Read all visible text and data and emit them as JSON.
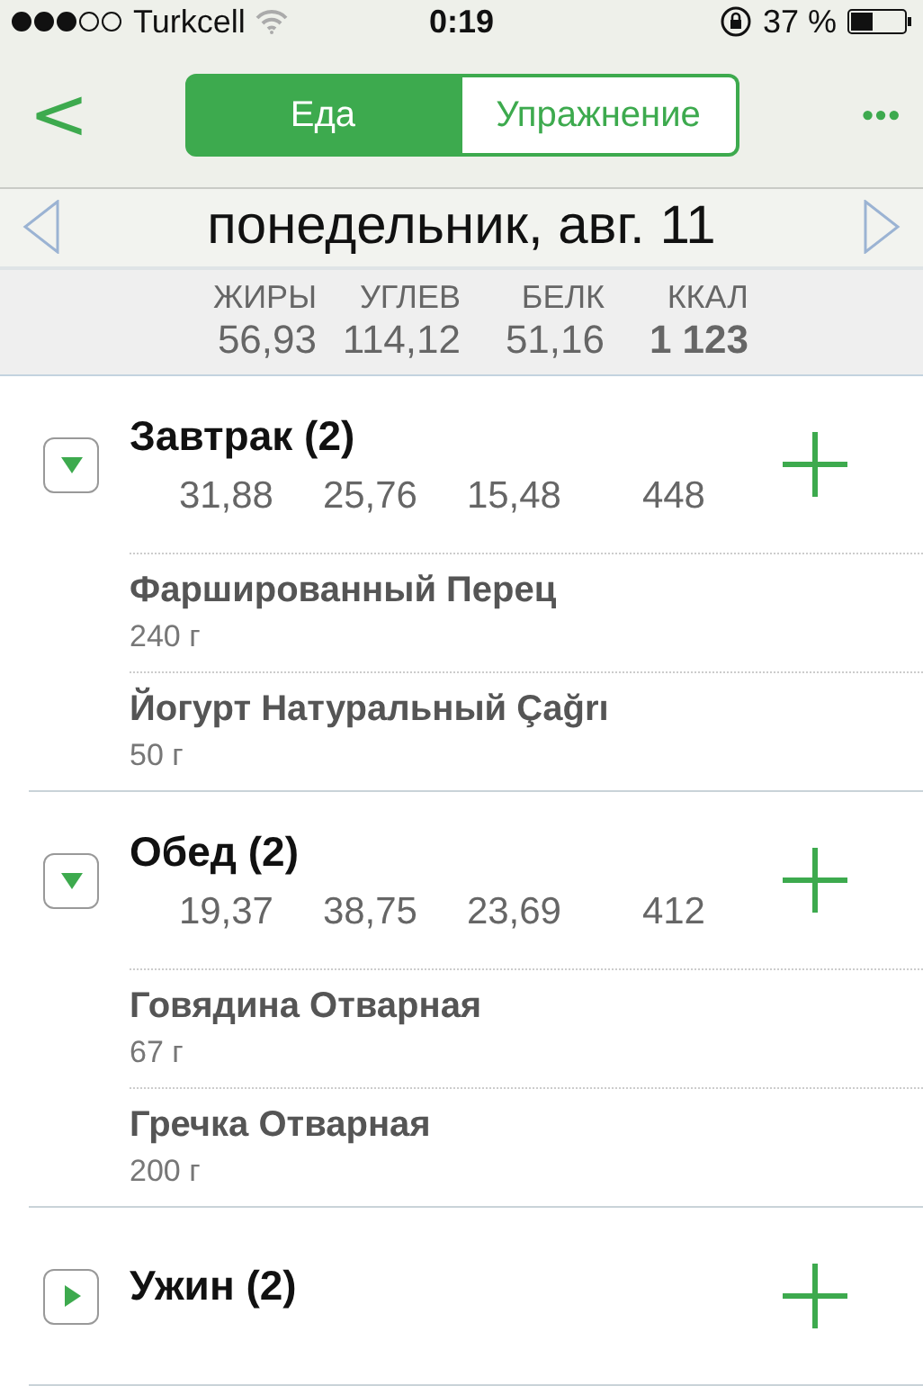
{
  "status_bar": {
    "carrier": "Turkcell",
    "time": "0:19",
    "battery": "37 %"
  },
  "nav": {
    "back": "<",
    "tabs": [
      {
        "label": "Еда",
        "selected": true
      },
      {
        "label": "Упражнение",
        "selected": false
      }
    ],
    "more": "•••"
  },
  "date_bar": {
    "title": "понедельник, авг. 11"
  },
  "totals": {
    "columns": [
      "ЖИРЫ",
      "УГЛЕВ",
      "БЕЛК",
      "ККАЛ"
    ],
    "values": [
      "56,93",
      "114,12",
      "51,16",
      "1 123"
    ]
  },
  "meals": [
    {
      "title": "Завтрак (2)",
      "expanded": true,
      "values": [
        "31,88",
        "25,76",
        "15,48",
        "448"
      ],
      "items": [
        {
          "name": "Фаршированный Перец",
          "amount": "240 г"
        },
        {
          "name": "Йогурт Натуральный Çağrı",
          "amount": "50 г"
        }
      ]
    },
    {
      "title": "Обед (2)",
      "expanded": true,
      "values": [
        "19,37",
        "38,75",
        "23,69",
        "412"
      ],
      "items": [
        {
          "name": "Говядина Отварная",
          "amount": "67 г"
        },
        {
          "name": "Гречка Отварная",
          "amount": "200 г"
        }
      ]
    },
    {
      "title": "Ужин (2)",
      "expanded": false
    }
  ]
}
